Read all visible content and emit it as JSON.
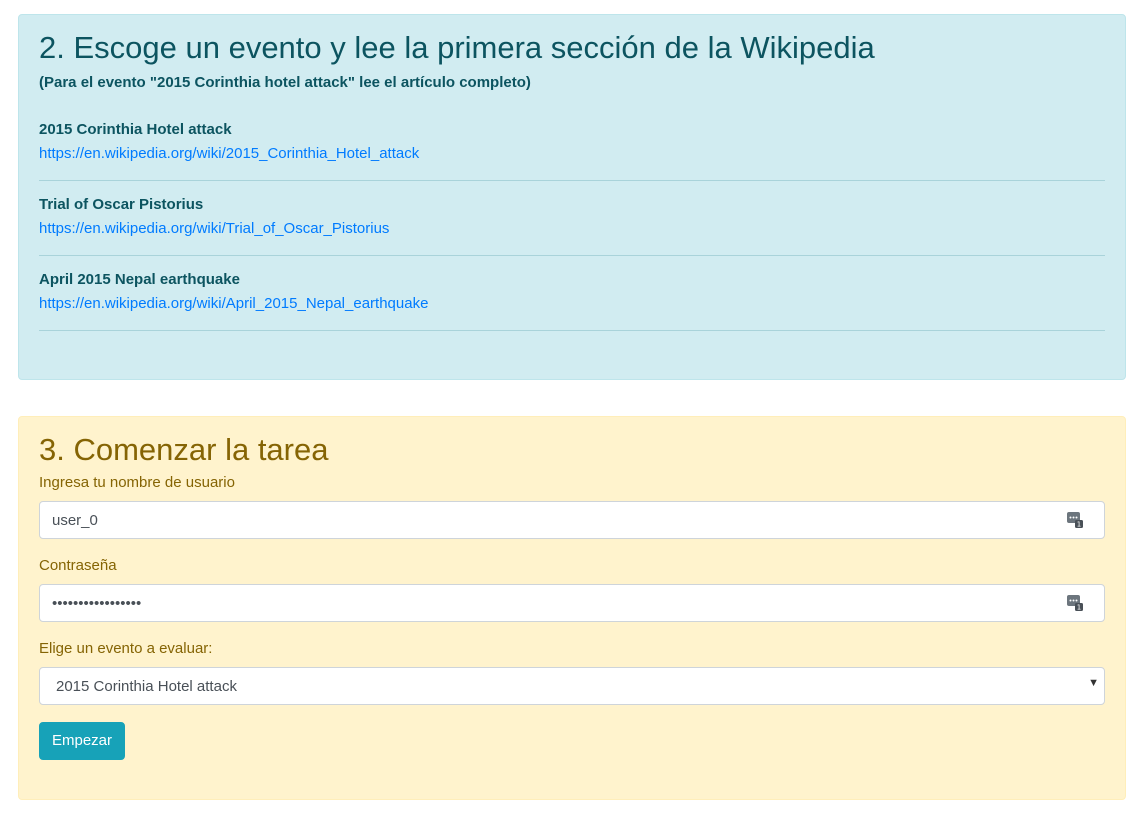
{
  "section2": {
    "title": "2. Escoge un evento y lee la primera sección de la Wikipedia",
    "subtitle": "(Para el evento \"2015 Corinthia hotel attack\" lee el artículo completo)",
    "events": [
      {
        "title": "2015 Corinthia Hotel attack",
        "url": "https://en.wikipedia.org/wiki/2015_Corinthia_Hotel_attack"
      },
      {
        "title": "Trial of Oscar Pistorius",
        "url": "https://en.wikipedia.org/wiki/Trial_of_Oscar_Pistorius"
      },
      {
        "title": "April 2015 Nepal earthquake",
        "url": "https://en.wikipedia.org/wiki/April_2015_Nepal_earthquake"
      }
    ]
  },
  "section3": {
    "title": "3. Comenzar la tarea",
    "username_label": "Ingresa tu nombre de usuario",
    "username_value": "user_0",
    "password_label": "Contraseña",
    "password_value": "•••••••••••••••••",
    "event_label": "Elige un evento a evaluar:",
    "event_selected": "2015 Corinthia Hotel attack",
    "start_button": "Empezar"
  },
  "colors": {
    "info_bg": "#d1ecf1",
    "info_text": "#0c5460",
    "warning_bg": "#fff3cd",
    "warning_text": "#856404",
    "link": "#007bff",
    "button": "#17a2b8"
  },
  "icons": {
    "password_manager": "password-manager-icon",
    "select_arrow": "chevron-down-icon"
  }
}
